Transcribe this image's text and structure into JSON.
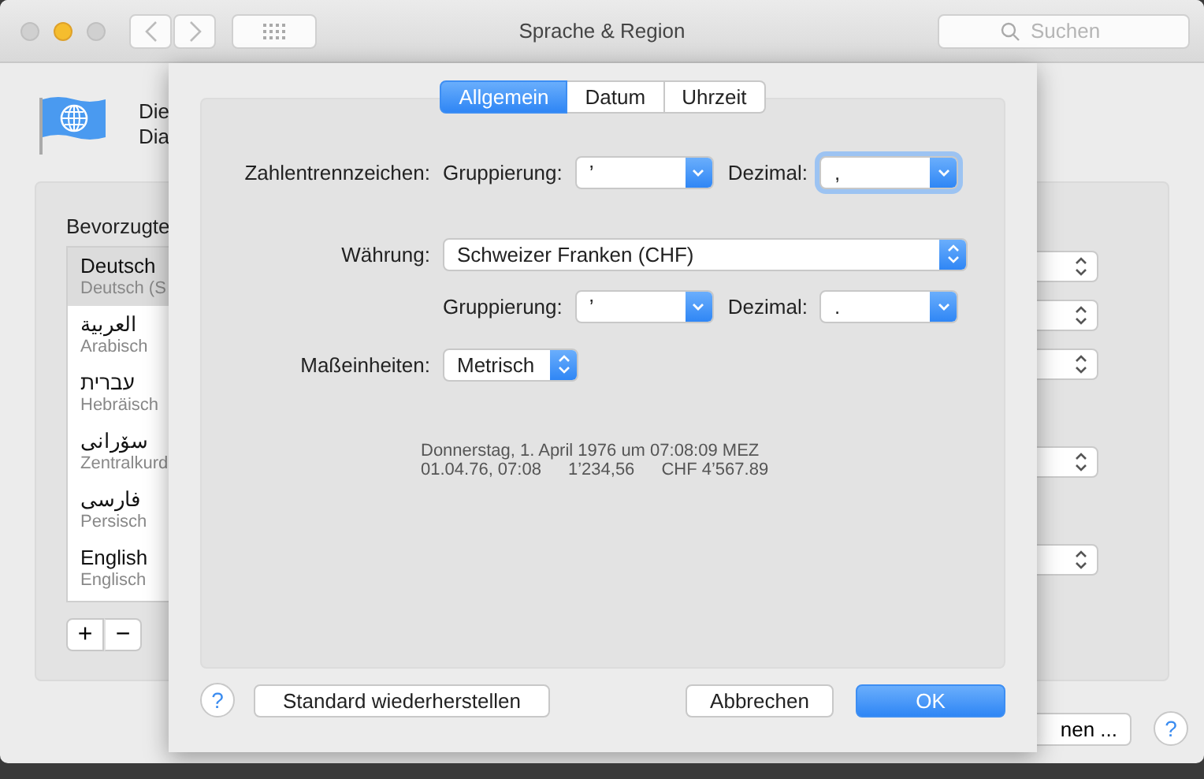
{
  "window": {
    "title": "Sprache & Region",
    "search": {
      "placeholder": "Suchen"
    }
  },
  "header": {
    "lines": [
      "Die",
      "Dia"
    ]
  },
  "languages_panel": {
    "title": "Bevorzugte",
    "items": [
      {
        "name": "Deutsch",
        "subtitle": "Deutsch (S",
        "selected": true
      },
      {
        "name": "العربية",
        "subtitle": "Arabisch",
        "selected": false
      },
      {
        "name": "עברית",
        "subtitle": "Hebräisch",
        "selected": false
      },
      {
        "name": "سۆرانی",
        "subtitle": "Zentralkurd",
        "selected": false
      },
      {
        "name": "فارسی",
        "subtitle": "Persisch",
        "selected": false
      },
      {
        "name": "English",
        "subtitle": "Englisch",
        "selected": false
      }
    ],
    "add": "+",
    "remove": "−"
  },
  "more_button": "nen ...",
  "sheet": {
    "tabs": [
      {
        "label": "Allgemein",
        "selected": true
      },
      {
        "label": "Datum",
        "selected": false
      },
      {
        "label": "Uhrzeit",
        "selected": false
      }
    ],
    "number_separators": {
      "label": "Zahlentrennzeichen:",
      "grouping_label": "Gruppierung:",
      "grouping_value": "’",
      "decimal_label": "Dezimal:",
      "decimal_value": ",",
      "decimal_focused": true
    },
    "currency": {
      "label": "Währung:",
      "value": "Schweizer Franken (CHF)",
      "grouping_label": "Gruppierung:",
      "grouping_value": "’",
      "decimal_label": "Dezimal:",
      "decimal_value": ".",
      "decimal_focused": false
    },
    "units": {
      "label": "Maßeinheiten:",
      "value": "Metrisch"
    },
    "preview": {
      "line_1": "Donnerstag, 1. April 1976 um 07:08:09 MEZ",
      "line_2": [
        "01.04.76, 07:08",
        "1’234,56",
        "CHF 4’567.89"
      ]
    },
    "help": "?",
    "restore_button": "Standard wiederherstellen",
    "cancel_button": "Abbrechen",
    "ok_button": "OK"
  }
}
